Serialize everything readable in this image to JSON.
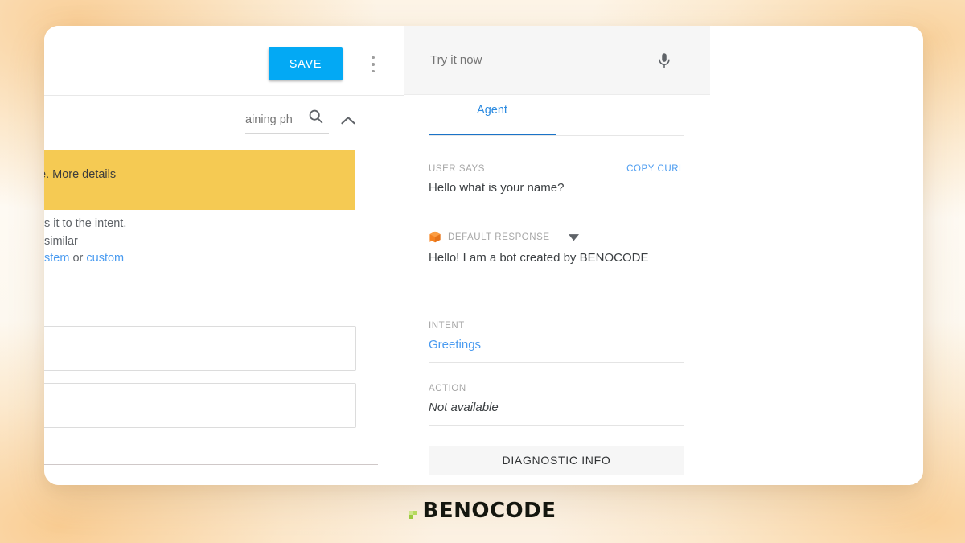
{
  "background": {
    "gradient_accent": "#f9cd94",
    "base": "#fdf6ec"
  },
  "window": {
    "card_background": "#ffffff"
  },
  "left_panel": {
    "toolbar": {
      "save_label": "SAVE",
      "save_color": "#03a9f4",
      "overflow_menu_icon": "kebab-menu-icon"
    },
    "search": {
      "value": "aining ph",
      "placeholder": "Search training phrases",
      "search_icon": "search-icon",
      "collapse_icon": "chevron-up-icon"
    },
    "warning_banner": {
      "text": "e. More details",
      "color": "#f5ca53"
    },
    "helper_text": {
      "line1": "s it to the intent.",
      "line2": "similar",
      "link1": "stem",
      "conjunction": " or ",
      "link2": "custom",
      "link_color": "#4a9bf0"
    },
    "entry_cards": [
      {
        "value": ""
      },
      {
        "value": ""
      }
    ],
    "collapse_bottom_icon": "chevron-up-icon"
  },
  "right_panel": {
    "try_it_now": {
      "placeholder": "Try it now",
      "value": "",
      "mic_icon": "microphone-icon",
      "header_background": "#f6f6f6"
    },
    "tabs": [
      {
        "label": "Agent",
        "active": true,
        "color": "#2b8ae0"
      }
    ],
    "user_says": {
      "label": "USER SAYS",
      "copy_curl_label": "COPY CURL",
      "value": "Hello what is your name?"
    },
    "default_response": {
      "icon": "dialogflow-cube-icon",
      "icon_color": "#f58220",
      "label": "DEFAULT RESPONSE",
      "dropdown_icon": "caret-down-icon",
      "value": "Hello! I am a bot created by BENOCODE"
    },
    "intent": {
      "label": "INTENT",
      "value": "Greetings",
      "value_color": "#4a9bf0"
    },
    "action": {
      "label": "ACTION",
      "value": "Not available"
    },
    "diagnostic_info": {
      "label": "DIAGNOSTIC INFO"
    }
  },
  "watermark": {
    "wordmark": "BENOCODE",
    "mark_color": "#9bc93f"
  }
}
